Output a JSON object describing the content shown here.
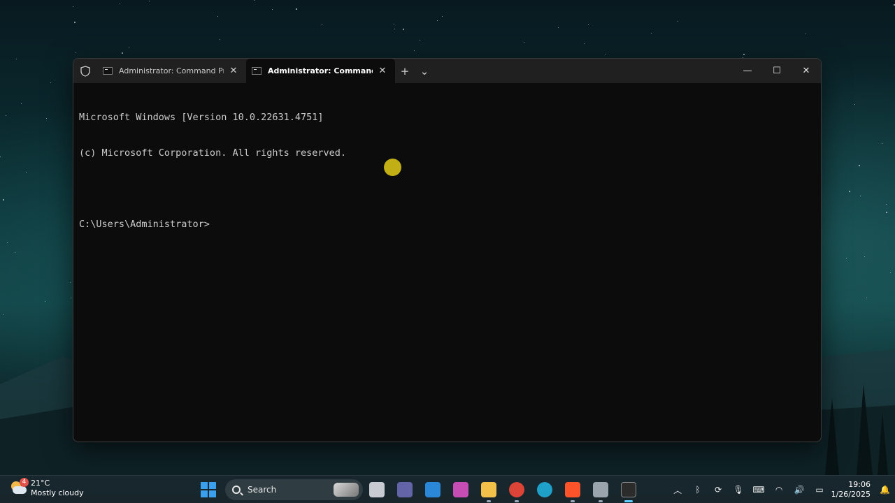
{
  "terminal": {
    "tabs": [
      {
        "title": "Administrator: Command Prompt",
        "active": false
      },
      {
        "title": "Administrator: Command Prompt",
        "active": true
      }
    ],
    "lines": [
      "Microsoft Windows [Version 10.0.22631.4751]",
      "(c) Microsoft Corporation. All rights reserved.",
      "",
      "C:\\Users\\Administrator>"
    ]
  },
  "taskbar": {
    "weather": {
      "badge": "4",
      "temperature": "21°C",
      "condition": "Mostly cloudy"
    },
    "search": {
      "placeholder": "Search"
    },
    "apps": [
      {
        "name": "task-view",
        "color": "#c8ccd2"
      },
      {
        "name": "teams",
        "color": "#6264a7"
      },
      {
        "name": "microsoft-store",
        "color": "#2b88d8"
      },
      {
        "name": "copilot",
        "color": "#c64db4"
      },
      {
        "name": "file-explorer",
        "color": "#f2c14a"
      },
      {
        "name": "chrome",
        "color": "#db4437"
      },
      {
        "name": "edge",
        "color": "#1fa0c9"
      },
      {
        "name": "brave",
        "color": "#fb542b"
      },
      {
        "name": "app-installer",
        "color": "#9aa4ad"
      },
      {
        "name": "windows-terminal",
        "color": "#2b2b2b"
      }
    ],
    "clock": {
      "time": "19:06",
      "date": "1/26/2025"
    }
  }
}
